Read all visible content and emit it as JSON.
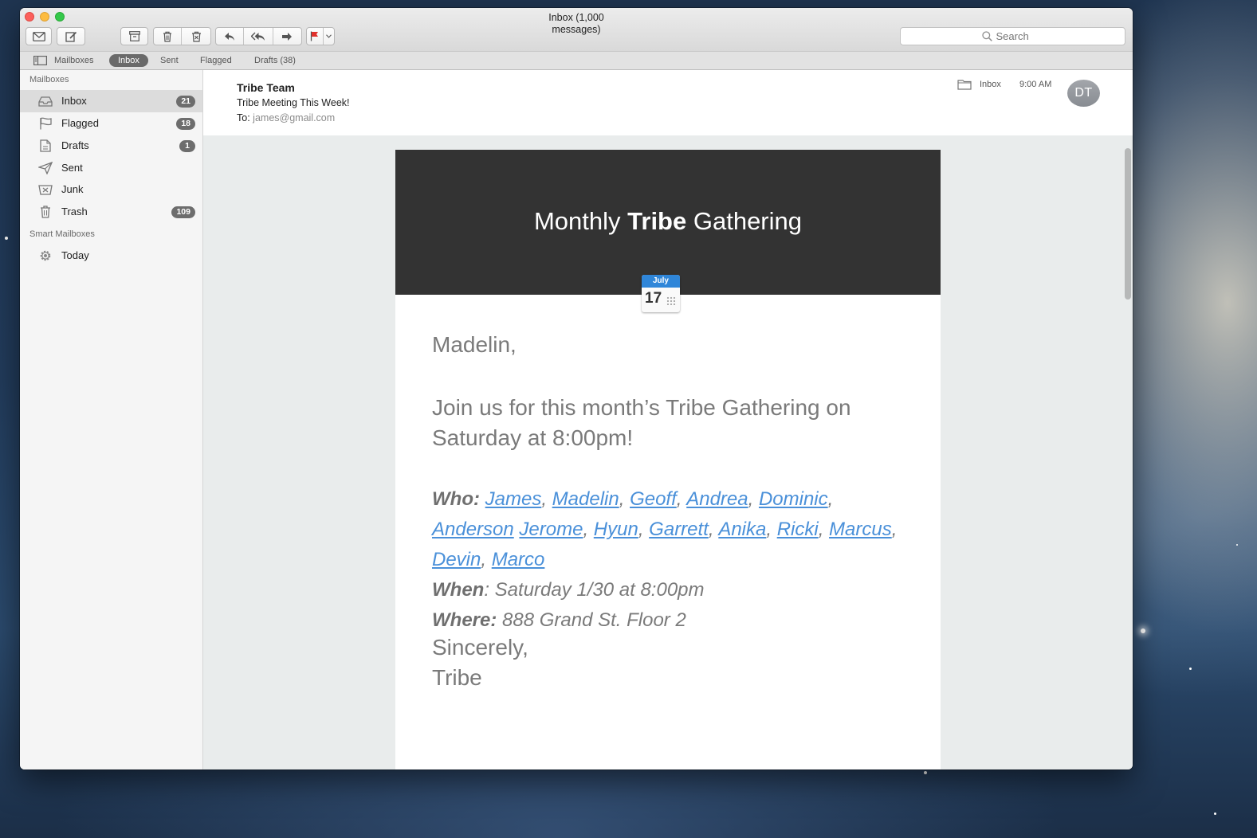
{
  "window": {
    "title": "Inbox (1,000 messages)"
  },
  "toolbar": {
    "buttons": [
      {
        "name": "get-mail",
        "icon": "envelope-icon"
      },
      {
        "name": "compose",
        "icon": "compose-icon"
      },
      {
        "name": "archive",
        "icon": "archive-icon"
      },
      {
        "name": "delete",
        "icon": "trash-icon"
      },
      {
        "name": "junk",
        "icon": "junk-icon"
      },
      {
        "name": "reply",
        "icon": "reply-icon"
      },
      {
        "name": "reply-all",
        "icon": "reply-all-icon"
      },
      {
        "name": "forward",
        "icon": "forward-icon"
      },
      {
        "name": "flag",
        "icon": "flag-icon",
        "color": "#e0302b"
      }
    ],
    "search_placeholder": "Search"
  },
  "favorites": [
    {
      "label": "Mailboxes"
    },
    {
      "label": "Inbox",
      "active": true
    },
    {
      "label": "Sent"
    },
    {
      "label": "Flagged"
    },
    {
      "label": "Drafts (38)"
    }
  ],
  "sidebar": {
    "mailboxes_header": "Mailboxes",
    "items": [
      {
        "label": "Inbox",
        "badge": "21",
        "icon": "inbox-tray-icon"
      },
      {
        "label": "Flagged",
        "badge": "18",
        "icon": "flag-outline-icon"
      },
      {
        "label": "Drafts",
        "badge": "1",
        "icon": "drafts-icon"
      },
      {
        "label": "Sent",
        "badge": "",
        "icon": "paper-plane-icon"
      },
      {
        "label": "Junk",
        "badge": "",
        "icon": "junk-tray-icon"
      },
      {
        "label": "Trash",
        "badge": "109",
        "icon": "trash-icon"
      }
    ],
    "smart_header": "Smart Mailboxes",
    "smart_items": [
      {
        "label": "Today",
        "icon": "gear-icon"
      }
    ]
  },
  "message": {
    "from": "Tribe Team",
    "subject": "Tribe Meeting This Week!",
    "to_label": "To:",
    "to_address": "james@gmail.com",
    "folder": "Inbox",
    "time": "9:00 AM",
    "avatar_initials": "DT"
  },
  "email": {
    "hero_pre": "Monthly ",
    "hero_bold": "Tribe",
    "hero_post": " Gathering",
    "calendar_month": "July",
    "calendar_day": "17",
    "greeting": "Madelin,",
    "invite": "Join us for this month’s Tribe Gathering on Saturday at 8:00pm!",
    "who_label": "Who:",
    "attendees": [
      "James",
      "Madelin",
      "Geoff",
      "Andrea",
      "Dominic",
      "Anderson",
      "Jerome",
      "Hyun",
      "Garrett",
      "Anika",
      "Ricki",
      "Marcus",
      "Devin",
      "Marco"
    ],
    "when_label": "When",
    "when_value": ": Saturday 1/30 at 8:00pm",
    "where_label": "Where:",
    "where_value": " 888 Grand St. Floor 2",
    "signoff": "Sincerely,",
    "signature": "Tribe"
  },
  "colors": {
    "accent_link": "#4a90d9",
    "hero_bg": "#333333",
    "badge_bg": "#6d6d6d",
    "calendar_blue": "#2f86d9"
  }
}
